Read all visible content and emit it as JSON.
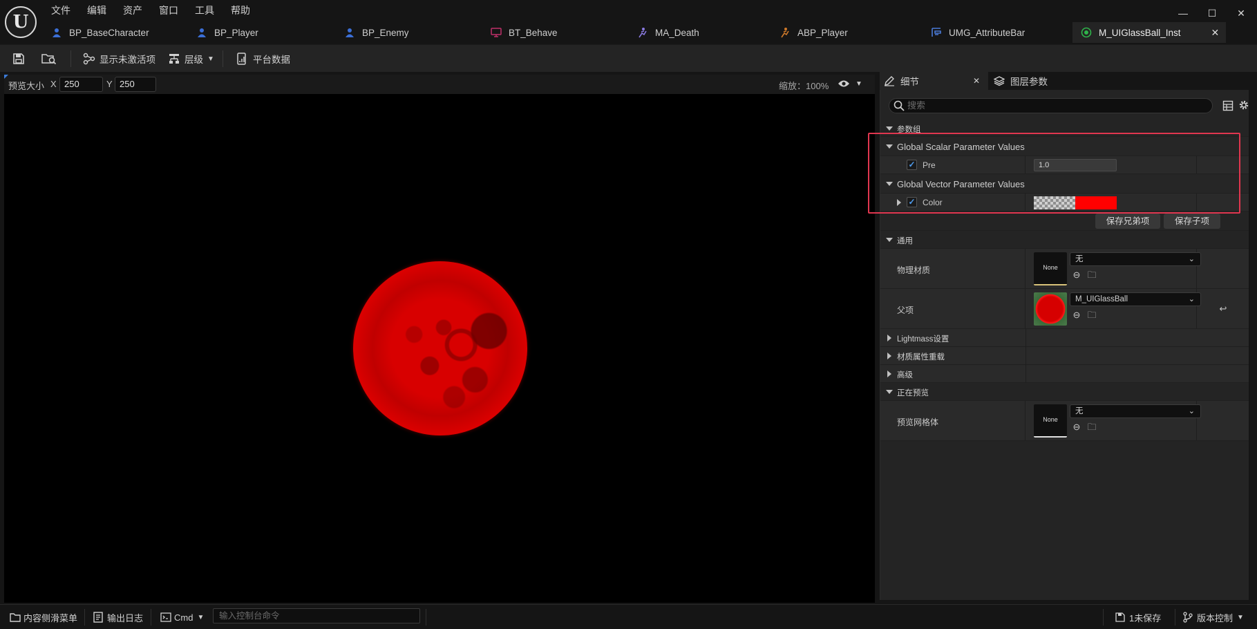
{
  "menu": [
    "文件",
    "编辑",
    "资产",
    "窗口",
    "工具",
    "帮助"
  ],
  "logo_text": "U",
  "window_controls": {
    "minimize": "—",
    "maximize": "☐",
    "close": "✕"
  },
  "tabs": [
    {
      "label": "BP_BaseCharacter",
      "icon": "blueprint-icon"
    },
    {
      "label": "BP_Player",
      "icon": "blueprint-icon"
    },
    {
      "label": "BP_Enemy",
      "icon": "blueprint-icon"
    },
    {
      "label": "BT_Behave",
      "icon": "behavior-tree-icon"
    },
    {
      "label": "MA_Death",
      "icon": "montage-icon"
    },
    {
      "label": "ABP_Player",
      "icon": "anim-blueprint-icon"
    },
    {
      "label": "UMG_AttributeBar",
      "icon": "widget-icon"
    },
    {
      "label": "M_UIGlassBall_Inst",
      "icon": "material-instance-icon",
      "close": "✕"
    }
  ],
  "toolbar": {
    "show_inactive": "显示未激活项",
    "hierarchy": "层级",
    "platform_data": "平台数据"
  },
  "viewport": {
    "preview_size_label": "预览大小",
    "x_label": "X",
    "x_value": "250",
    "y_label": "Y",
    "y_value": "250",
    "zoom": "缩放：100%"
  },
  "panel_tabs": {
    "details": "细节",
    "details_close": "✕",
    "layer_params": "图层参数"
  },
  "details": {
    "search_placeholder": "搜索",
    "param_group": "参数组",
    "scalar_group": "Global Scalar Parameter Values",
    "scalar_param_name": "Pre",
    "scalar_param_value": "1.0",
    "vector_group": "Global Vector Parameter Values",
    "vector_param_name": "Color",
    "save_sibling": "保存兄弟项",
    "save_child": "保存子项",
    "general": "通用",
    "phys_material_label": "物理材质",
    "phys_material_thumb": "None",
    "phys_material_value": "无",
    "parent_label": "父项",
    "parent_value": "M_UIGlassBall",
    "lightmass": "Lightmass设置",
    "material_override": "材质属性重载",
    "advanced": "高级",
    "previewing": "正在预览",
    "preview_mesh_label": "预览网格体",
    "preview_mesh_thumb": "None",
    "preview_mesh_value": "无"
  },
  "statusbar": {
    "content_drawer": "内容侧滑菜单",
    "output_log": "输出日志",
    "cmd": "Cmd",
    "cmd_placeholder": "输入控制台命令",
    "unsaved": "1未保存",
    "source_control": "版本控制"
  },
  "colors": {
    "accent_blue": "#4f9df0",
    "highlight_box": "#e0364f",
    "color_param": "#ff0000"
  }
}
